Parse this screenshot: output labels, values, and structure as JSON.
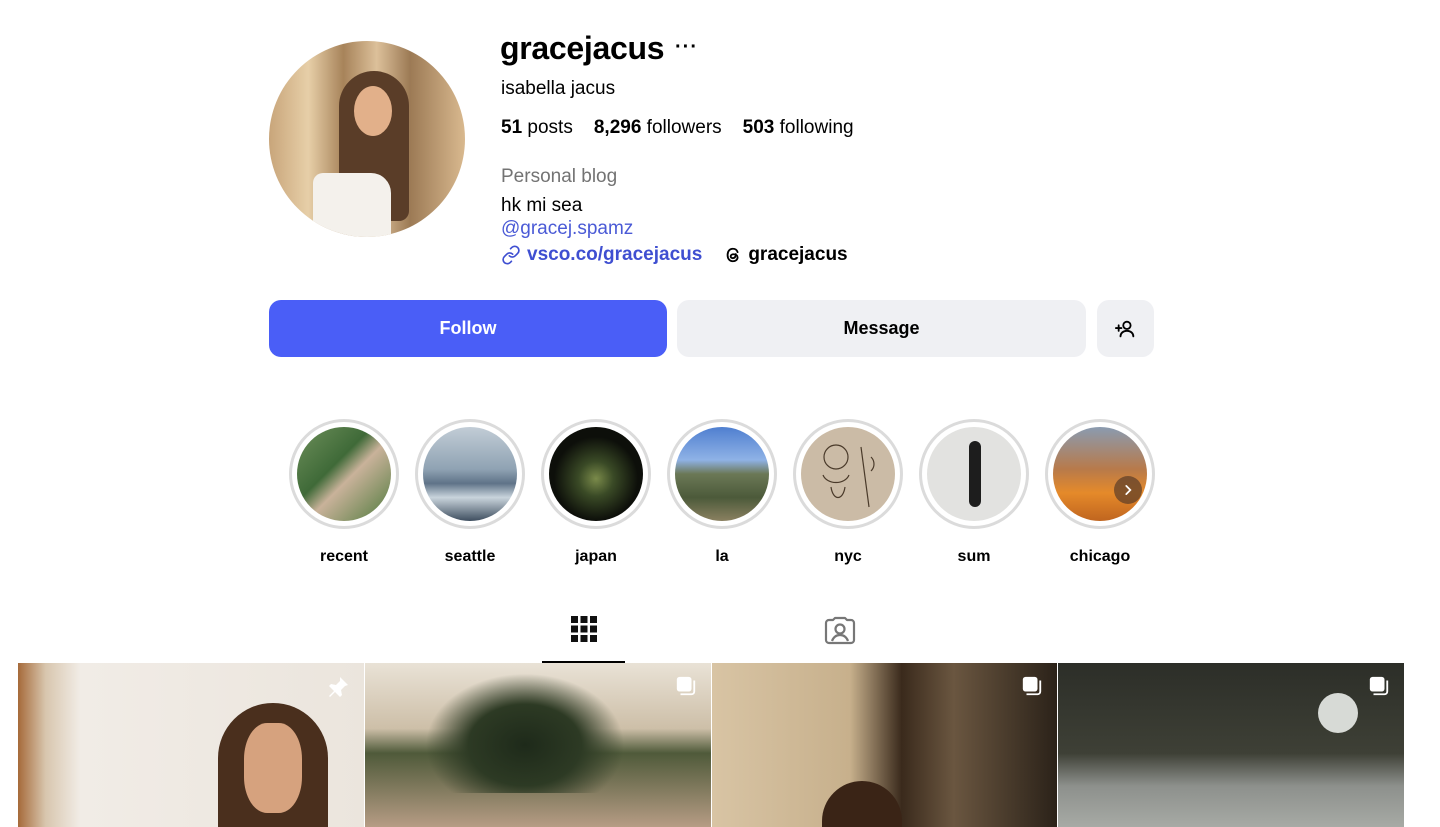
{
  "profile": {
    "username": "gracejacus",
    "more_label": "···",
    "full_name": "isabella jacus",
    "stats": {
      "posts_count": "51",
      "posts_label": "posts",
      "followers_count": "8,296",
      "followers_label": "followers",
      "following_count": "503",
      "following_label": "following"
    },
    "category": "Personal blog",
    "bio": "hk mi sea",
    "mention": "@gracej.spamz",
    "link": "vsco.co/gracejacus",
    "threads_handle": "gracejacus"
  },
  "actions": {
    "follow_label": "Follow",
    "message_label": "Message",
    "add_user_icon": "person-add-icon"
  },
  "highlights": [
    {
      "label": "recent"
    },
    {
      "label": "seattle"
    },
    {
      "label": "japan"
    },
    {
      "label": "la"
    },
    {
      "label": "nyc"
    },
    {
      "label": "sum"
    },
    {
      "label": "chicago"
    }
  ],
  "tabs": [
    {
      "icon": "grid-icon",
      "active": true
    },
    {
      "icon": "tagged-icon",
      "active": false
    }
  ],
  "posts": [
    {
      "badge": "pin-icon"
    },
    {
      "badge": "carousel-icon"
    },
    {
      "badge": "carousel-icon"
    },
    {
      "badge": "carousel-icon"
    }
  ],
  "colors": {
    "accent": "#4a5ef7",
    "link": "#3f4fd1",
    "secondary_button": "#eff0f3",
    "muted_text": "#737373"
  }
}
